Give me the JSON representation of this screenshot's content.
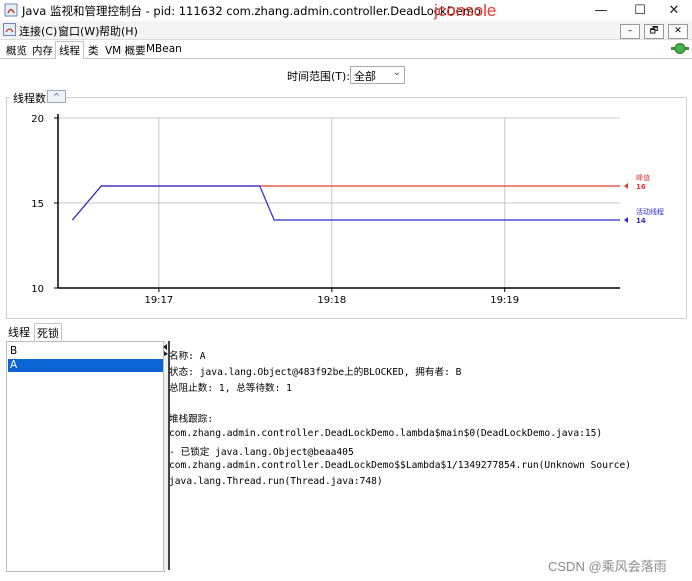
{
  "window": {
    "title": "Java 监视和管理控制台 - pid: 111632 com.zhang.admin.controller.DeadLockDemo",
    "overlay_title": "jconsole",
    "buttons": {
      "minimize": "—",
      "maximize": "☐",
      "close": "✕"
    }
  },
  "menu": {
    "items": [
      "连接(C)",
      "窗口(W)",
      "帮助(H)"
    ],
    "inner_buttons": [
      "–",
      "🗗",
      "✕"
    ]
  },
  "tabs": [
    "概览",
    "内存",
    "线程",
    "类",
    "VM 概要",
    "MBean"
  ],
  "active_tab": "线程",
  "time_range": {
    "label": "时间范围(T):",
    "value": "全部"
  },
  "chart_panel": {
    "label": "线程数",
    "collapse_icon": "^"
  },
  "chart_data": {
    "type": "line",
    "x": [
      "19:16:30",
      "19:16:40",
      "19:17:00",
      "19:17:30",
      "19:17:35",
      "19:17:40",
      "19:18:00",
      "19:19:00",
      "19:19:40"
    ],
    "xticks": [
      "19:17",
      "19:18",
      "19:19"
    ],
    "ylim": [
      10,
      20
    ],
    "yticks": [
      10,
      15,
      20
    ],
    "series": [
      {
        "name": "峰值",
        "color": "#e53935",
        "values": [
          14,
          16,
          16,
          16,
          16,
          16,
          16,
          16,
          16
        ],
        "last": 16
      },
      {
        "name": "活动线程",
        "color": "#2b2bd0",
        "values": [
          14,
          16,
          16,
          16,
          16,
          14,
          14,
          14,
          14
        ],
        "last": 14
      }
    ],
    "grid": true
  },
  "subtabs": [
    "线程",
    "死锁"
  ],
  "active_subtab": "死锁",
  "thread_list": [
    "B",
    "A"
  ],
  "selected_thread": "A",
  "details": [
    "名称: A",
    "状态: java.lang.Object@483f92be上的BLOCKED, 拥有者: B",
    "总阻止数: 1, 总等待数: 1",
    "",
    "堆栈跟踪:",
    "com.zhang.admin.controller.DeadLockDemo.lambda$main$0(DeadLockDemo.java:15)",
    "   - 已锁定 java.lang.Object@beaa405",
    "com.zhang.admin.controller.DeadLockDemo$$Lambda$1/1349277854.run(Unknown Source)",
    "java.lang.Thread.run(Thread.java:748)"
  ],
  "watermark": "CSDN @乘风会落雨"
}
